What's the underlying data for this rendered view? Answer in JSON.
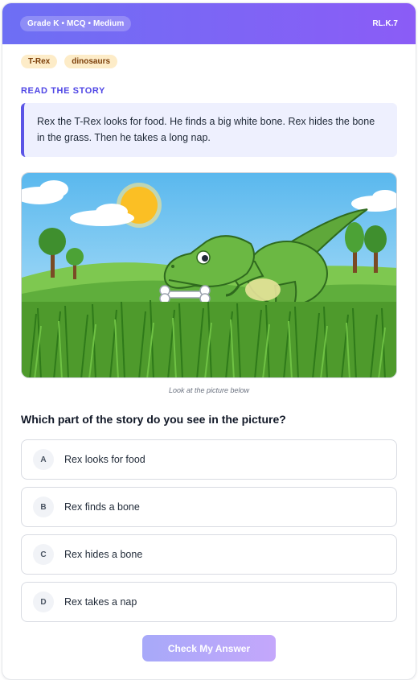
{
  "header": {
    "grade_pill": "Grade K • MCQ • Medium",
    "standard": "RL.K.7"
  },
  "tags": [
    "T-Rex",
    "dinosaurs"
  ],
  "story": {
    "label": "READ THE STORY",
    "text": "Rex the T-Rex looks for food. He finds a big white bone. Rex hides the bone in the grass. Then he takes a long nap."
  },
  "picture": {
    "caption": "Look at the picture below",
    "icon": "dinosaur-bone-grass-illustration"
  },
  "question": "Which part of the story do you see in the picture?",
  "options": [
    {
      "letter": "A",
      "text": "Rex looks for food"
    },
    {
      "letter": "B",
      "text": "Rex finds a bone"
    },
    {
      "letter": "C",
      "text": "Rex hides a bone"
    },
    {
      "letter": "D",
      "text": "Rex takes a nap"
    }
  ],
  "submit_label": "Check My Answer",
  "colors": {
    "accent": "#6d6ff4",
    "accent_end": "#8b5cf6",
    "tag_bg": "#fdecc8"
  }
}
